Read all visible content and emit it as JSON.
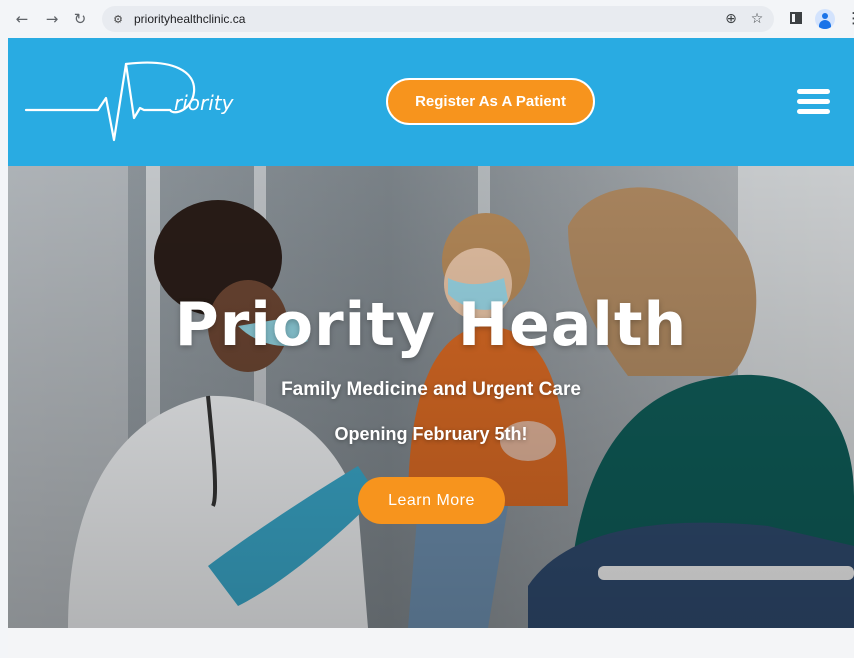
{
  "browser": {
    "url": "priorityhealthclinic.ca",
    "icons": [
      "back-icon",
      "forward-icon",
      "reload-icon",
      "site-info-icon",
      "zoom-icon",
      "bookmark-star-icon",
      "side-panel-icon",
      "profile-avatar-icon",
      "menu-kebab-icon"
    ],
    "glyphs": {
      "back": "←",
      "forward": "→",
      "reload": "↻",
      "site_info": "⚙",
      "zoom": "⊕",
      "star": "☆",
      "kebab": "⋮"
    }
  },
  "header": {
    "background_color": "#29abe2",
    "logo_text": "riority",
    "register_button": "Register As A Patient",
    "accent_color": "#f7941d"
  },
  "hero": {
    "title": "Priority Health",
    "subtitle": "Family Medicine and Urgent Care",
    "opening": "Opening February 5th!",
    "cta_button": "Learn More"
  }
}
